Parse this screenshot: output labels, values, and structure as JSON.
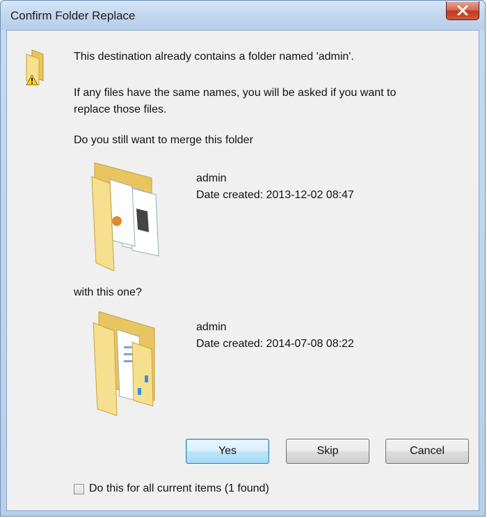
{
  "window": {
    "title": "Confirm Folder Replace",
    "close_glyph": "✕"
  },
  "message": {
    "line1": "This destination already contains a folder named 'admin'.",
    "line2a": "If any files have the same names, you will be asked if you want to",
    "line2b": "replace those files.",
    "line3": "Do you still want to merge this folder"
  },
  "source_folder": {
    "name": "admin",
    "date": "Date created: 2013-12-02 08:47",
    "icon": "folder-with-images-icon"
  },
  "separator_text": "with this one?",
  "dest_folder": {
    "name": "admin",
    "date": "Date created: 2014-07-08 08:22",
    "icon": "folder-with-documents-icon"
  },
  "buttons": {
    "yes": "Yes",
    "skip": "Skip",
    "cancel": "Cancel"
  },
  "checkbox": {
    "label": "Do this for all current items (1 found)",
    "checked": false
  },
  "colors": {
    "titlebar": "#c4d8ef",
    "close_button": "#c1391c",
    "default_button": "#bee6fd",
    "folder": "#f0d57a"
  }
}
